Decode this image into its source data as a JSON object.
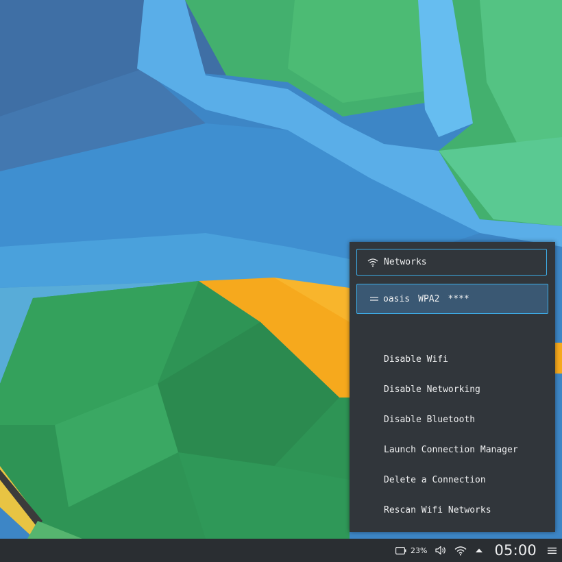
{
  "network_popup": {
    "header_label": "Networks",
    "connection": {
      "name": "oasis",
      "security": "WPA2",
      "password": "****"
    },
    "menu_items": [
      "Disable Wifi",
      "Disable Networking",
      "Disable Bluetooth",
      "Launch Connection Manager",
      "Delete a Connection",
      "Rescan Wifi Networks"
    ]
  },
  "panel": {
    "battery_percent": "23%",
    "clock": "05:00"
  },
  "colors": {
    "accent": "#3daee9",
    "popup_bg": "#31363b",
    "panel_bg": "#2a2e32",
    "selected_row": "#3a5873"
  }
}
